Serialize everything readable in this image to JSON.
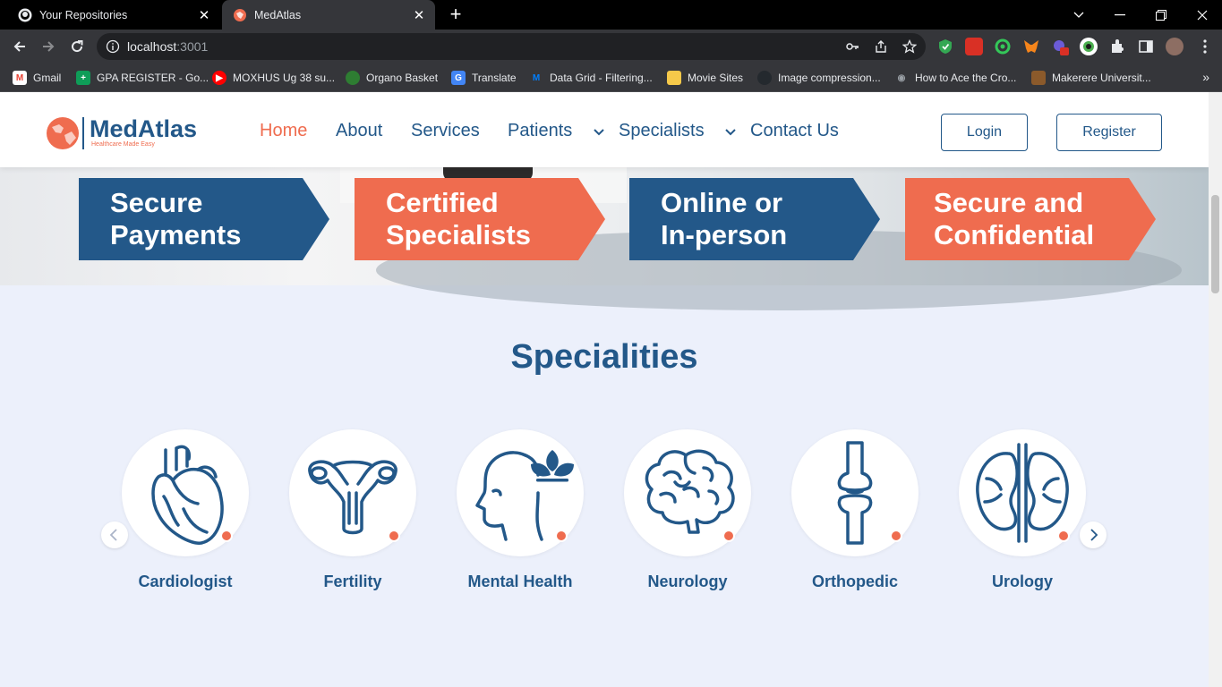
{
  "browser": {
    "tabs": [
      {
        "title": "Your Repositories",
        "icon": "github-icon"
      },
      {
        "title": "MedAtlas",
        "icon": "medatlas-favicon"
      }
    ],
    "url_host": "localhost",
    "url_port": ":3001",
    "bookmarks": [
      {
        "label": "Gmail",
        "icon": "gmail-icon",
        "color": "#ea4335"
      },
      {
        "label": "GPA REGISTER - Go...",
        "icon": "sheets-icon",
        "color": "#0f9d58"
      },
      {
        "label": "MOXHUS Ug 38 su...",
        "icon": "youtube-icon",
        "color": "#ff0000"
      },
      {
        "label": "Organo Basket",
        "icon": "organo-icon",
        "color": "#34a853"
      },
      {
        "label": "Translate",
        "icon": "translate-icon",
        "color": "#4285f4"
      },
      {
        "label": "Data Grid - Filtering...",
        "icon": "mui-icon",
        "color": "#007fff"
      },
      {
        "label": "Movie Sites",
        "icon": "folder-icon",
        "color": "#f6c94a"
      },
      {
        "label": "Image compression...",
        "icon": "github-icon",
        "color": "#24292e"
      },
      {
        "label": "How to Ace the Cro...",
        "icon": "eye-icon",
        "color": "#5f6368"
      },
      {
        "label": "Makerere Universit...",
        "icon": "makerere-icon",
        "color": "#8b5a2b"
      }
    ]
  },
  "site": {
    "logo_name": "MedAtlas",
    "logo_tagline": "Healthcare Made Easy",
    "nav": {
      "home": "Home",
      "about": "About",
      "services": "Services",
      "patients": "Patients",
      "specialists": "Specialists",
      "contact": "Contact Us"
    },
    "login": "Login",
    "register": "Register",
    "features": [
      {
        "line1": "Secure",
        "line2": "Payments"
      },
      {
        "line1": "Certified",
        "line2": "Specialists"
      },
      {
        "line1": "Online or",
        "line2": "In-person"
      },
      {
        "line1": "Secure and",
        "line2": "Confidential"
      }
    ],
    "specialities_title": "Specialities",
    "specialities": [
      {
        "label": "Cardiologist",
        "icon": "heart-icon"
      },
      {
        "label": "Fertility",
        "icon": "uterus-icon"
      },
      {
        "label": "Mental Health",
        "icon": "mental-health-icon"
      },
      {
        "label": "Neurology",
        "icon": "brain-icon"
      },
      {
        "label": "Orthopedic",
        "icon": "bone-icon"
      },
      {
        "label": "Urology",
        "icon": "kidney-icon"
      }
    ],
    "colors": {
      "primary": "#235889",
      "accent": "#ef6c4f",
      "background": "#ecf0fb"
    }
  }
}
